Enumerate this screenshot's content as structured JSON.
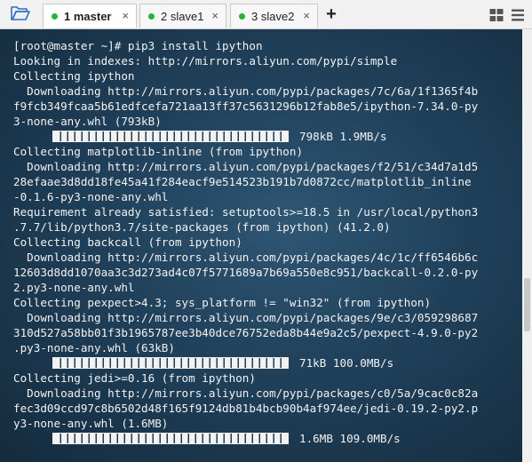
{
  "tabs": [
    {
      "number": "1",
      "name": "master",
      "label": "1 master",
      "active": true,
      "status_color": "#27b23c"
    },
    {
      "number": "2",
      "name": "slave1",
      "label": "2 slave1",
      "active": false,
      "status_color": "#27b23c"
    },
    {
      "number": "3",
      "name": "slave2",
      "label": "3 slave2",
      "active": false,
      "status_color": "#27b23c"
    }
  ],
  "tab_close_glyph": "×",
  "new_tab_glyph": "+",
  "icons": {
    "open_folder": "folder-open-icon",
    "layout": "grid-layout-icon",
    "menu": "hamburger-menu-icon"
  },
  "colors": {
    "folder_icon": "#2d6fc4",
    "terminal_text": "#f2f2f2",
    "terminal_bg": "#20405a"
  },
  "terminal": {
    "lines": [
      "[root@master ~]# pip3 install ipython",
      "Looking in indexes: http://mirrors.aliyun.com/pypi/simple",
      "Collecting ipython",
      "  Downloading http://mirrors.aliyun.com/pypi/packages/7c/6a/1f1365f4b",
      "f9fcb349fcaa5b61edfcefa721aa13ff37c5631296b12fab8e5/ipython-7.34.0-py",
      "3-none-any.whl (793kB)",
      "",
      "Collecting matplotlib-inline (from ipython)",
      "  Downloading http://mirrors.aliyun.com/pypi/packages/f2/51/c34d7a1d5",
      "28efaae3d8dd18fe45a41f284eacf9e514523b191b7d0872cc/matplotlib_inline",
      "-0.1.6-py3-none-any.whl",
      "Requirement already satisfied: setuptools>=18.5 in /usr/local/python3",
      ".7.7/lib/python3.7/site-packages (from ipython) (41.2.0)",
      "Collecting backcall (from ipython)",
      "  Downloading http://mirrors.aliyun.com/pypi/packages/4c/1c/ff6546b6c",
      "12603d8dd1070aa3c3d273ad4c07f5771689a7b69a550e8c951/backcall-0.2.0-py",
      "2.py3-none-any.whl",
      "Collecting pexpect>4.3; sys_platform != \"win32\" (from ipython)",
      "  Downloading http://mirrors.aliyun.com/pypi/packages/9e/c3/059298687",
      "310d527a58bb01f3b1965787ee3b40dce76752eda8b44e9a2c5/pexpect-4.9.0-py2",
      ".py3-none-any.whl (63kB)",
      "",
      "Collecting jedi>=0.16 (from ipython)",
      "  Downloading http://mirrors.aliyun.com/pypi/packages/c0/5a/9cac0c82a",
      "fec3d09ccd97c8b6502d48f165f9124db81b4bcb90b4af974ee/jedi-0.19.2-py2.p",
      "y3-none-any.whl (1.6MB)",
      ""
    ],
    "progress": [
      {
        "line_index": 6,
        "stats": "798kB 1.9MB/s",
        "fraction": 1.0
      },
      {
        "line_index": 21,
        "stats": "71kB 100.0MB/s",
        "fraction": 1.0
      },
      {
        "line_index": 26,
        "stats": "1.6MB 109.0MB/s",
        "fraction": 1.0
      }
    ]
  }
}
